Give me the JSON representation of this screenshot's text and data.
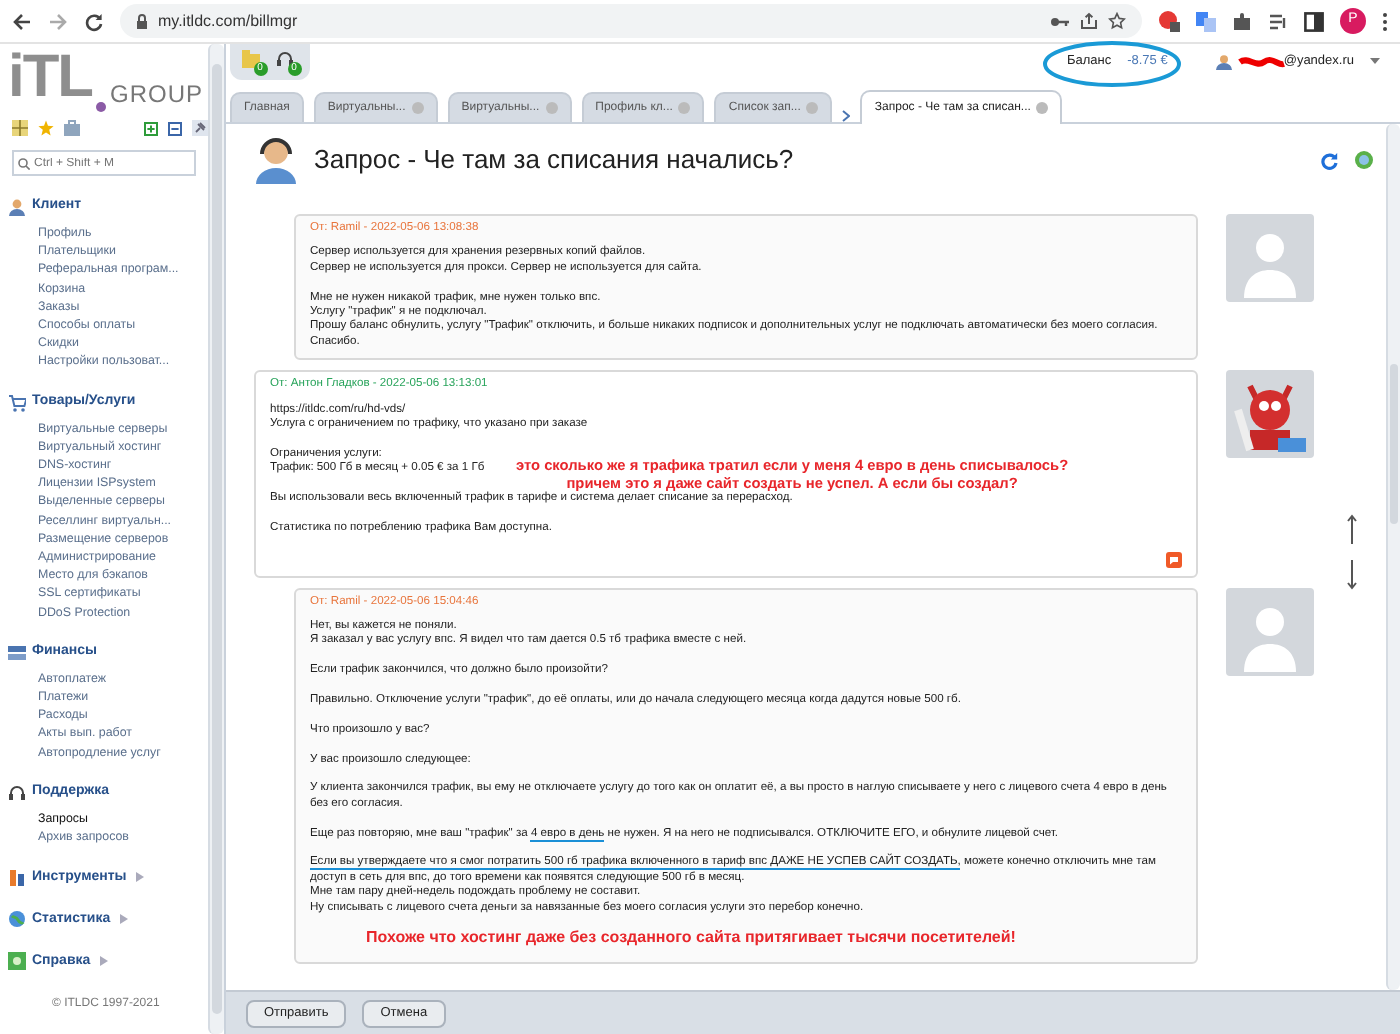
{
  "browser": {
    "url": "my.itldc.com/billmgr",
    "profile_initial": "P"
  },
  "logo": {
    "mark": "iTL",
    "word": "GROUP"
  },
  "toolbar": {
    "badges": [
      "0",
      "0"
    ]
  },
  "account": {
    "balance_label": "Баланс",
    "balance": "-8.75 €",
    "user": "@yandex.ru"
  },
  "sidebar": {
    "search_placeholder": "Ctrl + Shift + M",
    "sections": [
      {
        "title": "Клиент",
        "expanded": true,
        "items": [
          {
            "label": "Профиль",
            "selected": false
          },
          {
            "label": "Плательщики",
            "selected": false
          },
          {
            "label": "Реферальная програм...",
            "selected": false
          },
          {
            "label": "Корзина",
            "selected": false
          },
          {
            "label": "Заказы",
            "selected": false
          },
          {
            "label": "Способы оплаты",
            "selected": false
          },
          {
            "label": "Скидки",
            "selected": false
          },
          {
            "label": "Настройки пользоват...",
            "selected": false
          }
        ]
      },
      {
        "title": "Товары/Услуги",
        "expanded": true,
        "items": [
          {
            "label": "Виртуальные серверы",
            "selected": false
          },
          {
            "label": "Виртуальный хостинг",
            "selected": false
          },
          {
            "label": "DNS-хостинг",
            "selected": false
          },
          {
            "label": "Лицензии ISPsystem",
            "selected": false
          },
          {
            "label": "Выделенные серверы",
            "selected": false
          },
          {
            "label": "Реселлинг виртуальн...",
            "selected": false
          },
          {
            "label": "Размещение серверов",
            "selected": false
          },
          {
            "label": "Администрирование",
            "selected": false
          },
          {
            "label": "Место для бэкапов",
            "selected": false
          },
          {
            "label": "SSL сертификаты",
            "selected": false
          },
          {
            "label": "DDoS Protection",
            "selected": false
          }
        ]
      },
      {
        "title": "Финансы",
        "expanded": true,
        "items": [
          {
            "label": "Автоплатеж",
            "selected": false
          },
          {
            "label": "Платежи",
            "selected": false
          },
          {
            "label": "Расходы",
            "selected": false
          },
          {
            "label": "Акты вып. работ",
            "selected": false
          },
          {
            "label": "Автопродление услуг",
            "selected": false
          }
        ]
      },
      {
        "title": "Поддержка",
        "expanded": true,
        "items": [
          {
            "label": "Запросы",
            "selected": true
          },
          {
            "label": "Архив запросов",
            "selected": false
          }
        ]
      },
      {
        "title": "Инструменты",
        "expanded": false
      },
      {
        "title": "Статистика",
        "expanded": false
      },
      {
        "title": "Справка",
        "expanded": false
      }
    ],
    "copyright": "© ITLDC 1997-2021"
  },
  "tabs": [
    {
      "label": "Главная",
      "selected": false,
      "closable": false
    },
    {
      "label": "Виртуальны...",
      "selected": false,
      "closable": true
    },
    {
      "label": "Виртуальны...",
      "selected": false,
      "closable": true
    },
    {
      "label": "Профиль кл...",
      "selected": false,
      "closable": true
    },
    {
      "label": "Список зап...",
      "selected": false,
      "closable": true
    },
    {
      "label": "Запрос - Че там за списан...",
      "selected": true,
      "closable": true
    }
  ],
  "ticket": {
    "title": "Запрос - Че там за списания начались?"
  },
  "messages": [
    {
      "kind": "client",
      "author": "От: Ramil - 2022-05-06 13:08:38",
      "paragraphs": [
        "Сервер используется для хранения резервных копий файлов.\nСервер не используется для прокси. Сервер не используется для сайта.",
        "Мне не нужен никакой трафик, мне нужен только впс.\nУслугу \"трафик\" я не подключал.\nПрошу баланс обнулить, услугу \"Трафик\" отключить, и больше никаких подписок и дополнительных услуг не подключать автоматически без моего согласия.\nСпасибо."
      ]
    },
    {
      "kind": "staff",
      "author": "От: Антон Гладков - 2022-05-06 13:13:01",
      "paragraphs": [
        "https://itldc.com/ru/hd-vds/\nУслуга с ограничением по трафику, что указано при заказе",
        "Ограничения услуги:\nТрафик: 500 Гб в месяц + 0.05 € за 1 Гб",
        "Вы использовали весь включенный трафик в тарифе и система делает списание за перерасход.",
        "Статистика по потреблению трафика Вам доступна."
      ],
      "overlay_note": [
        "это сколько же я трафика тратил если у меня 4 евро в день списывалось?",
        "причем это я даже сайт создать не успел. А если бы создал?"
      ]
    },
    {
      "kind": "client",
      "author": "От: Ramil - 2022-05-06 15:04:46",
      "paragraphs": [
        "Нет, вы кажется не поняли.\nЯ заказал у вас услугу впс. Я видел что там дается 0.5 тб трафика вместе с ней.",
        "Если трафик закончился, что должно было произойти?",
        "Правильно. Отключение услуги \"трафик\", до её оплаты, или до начала следующего месяца когда дадутся новые 500 гб.",
        "Что произошло у вас?",
        "У вас произошло следующее:",
        "У клиента закончился трафик, вы ему не отключаете услугу до того как он оплатит её, а вы просто в наглую списываете у него с лицевого счета 4 евро в день без его согласия.",
        {
          "segments": [
            {
              "text": "Еще раз повторяю, мне ваш \"трафик\" за ",
              "underlined": false
            },
            {
              "text": "4 евро в день",
              "underlined": true
            },
            {
              "text": " не нужен. Я на него не подписывался. ОТКЛЮЧИТЕ ЕГО, и обнулите лицевой счет.",
              "underlined": false
            }
          ]
        },
        {
          "segments": [
            {
              "text": "Если вы утверждаете что я смог потратить 500 гб трафика включенного в тариф впс ДАЖЕ НЕ УСПЕВ САЙТ СОЗДАТЬ,",
              "underlined": true
            },
            {
              "text": " можете конечно отключить мне там доступ в сеть для впс, до того времени как появятся следующие 500 гб в месяц.\nМне там пару дней-недель подождать проблему не составит.\nНу списывать с лицевого счета деньги за навязанные без моего согласия услуги это перебор конечно.",
              "underlined": false
            }
          ]
        }
      ],
      "note": "Похоже что хостинг даже без созданного сайта притягивает тысячи посетителей!"
    }
  ],
  "buttons": [
    "Отправить",
    "Отмена"
  ]
}
